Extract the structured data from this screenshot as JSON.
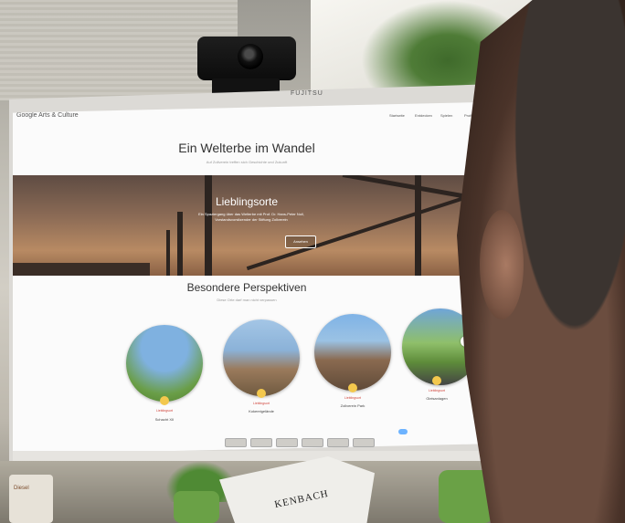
{
  "monitor_brand": "FUJITSU",
  "website": {
    "logo": "Google Arts & Culture",
    "nav": [
      "Startseite",
      "Entdecken",
      "Spielen",
      "Profil"
    ],
    "hero_title": "Ein Welterbe im Wandel",
    "hero_subtitle": "Auf Zollverein treffen sich Geschichte und Zukunft",
    "banner": {
      "title": "Lieblingsorte",
      "text": "Ein Spaziergang über das Welterbe mit Prof. Dr. Hans-Peter Noll, Vorstandsvorsitzender der Stiftung Zollverein",
      "button": "Ansehen"
    },
    "section_title": "Besondere Perspektiven",
    "section_subtitle": "Diese Orte darf man nicht verpassen",
    "places": [
      {
        "category": "Lieblingsort",
        "name": "Schacht XII"
      },
      {
        "category": "Lieblingsort",
        "name": "Kokereigelände"
      },
      {
        "category": "Lieblingsort",
        "name": "Zollverein Park"
      },
      {
        "category": "Lieblingsort",
        "name": "Gleisanlagen"
      }
    ],
    "next_arrow": "›"
  },
  "newspaper_text": "KENBACH",
  "mug_text": "Diesel"
}
